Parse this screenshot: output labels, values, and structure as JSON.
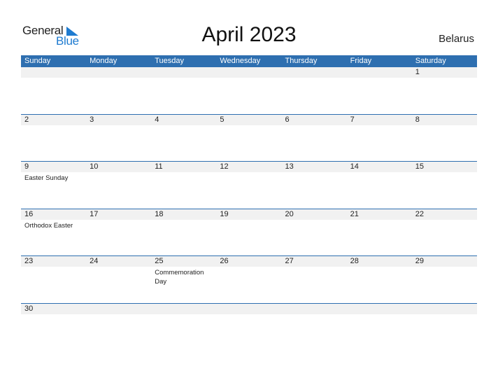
{
  "logo": {
    "text_general": "General",
    "text_blue": "Blue"
  },
  "title": "April 2023",
  "country": "Belarus",
  "colors": {
    "accent": "#2e6fb0",
    "band": "#f1f1f1"
  },
  "weekdays": [
    "Sunday",
    "Monday",
    "Tuesday",
    "Wednesday",
    "Thursday",
    "Friday",
    "Saturday"
  ],
  "weeks": [
    {
      "days": [
        {
          "n": "",
          "e": ""
        },
        {
          "n": "",
          "e": ""
        },
        {
          "n": "",
          "e": ""
        },
        {
          "n": "",
          "e": ""
        },
        {
          "n": "",
          "e": ""
        },
        {
          "n": "",
          "e": ""
        },
        {
          "n": "1",
          "e": ""
        }
      ]
    },
    {
      "days": [
        {
          "n": "2",
          "e": ""
        },
        {
          "n": "3",
          "e": ""
        },
        {
          "n": "4",
          "e": ""
        },
        {
          "n": "5",
          "e": ""
        },
        {
          "n": "6",
          "e": ""
        },
        {
          "n": "7",
          "e": ""
        },
        {
          "n": "8",
          "e": ""
        }
      ]
    },
    {
      "days": [
        {
          "n": "9",
          "e": "Easter Sunday"
        },
        {
          "n": "10",
          "e": ""
        },
        {
          "n": "11",
          "e": ""
        },
        {
          "n": "12",
          "e": ""
        },
        {
          "n": "13",
          "e": ""
        },
        {
          "n": "14",
          "e": ""
        },
        {
          "n": "15",
          "e": ""
        }
      ]
    },
    {
      "days": [
        {
          "n": "16",
          "e": "Orthodox Easter"
        },
        {
          "n": "17",
          "e": ""
        },
        {
          "n": "18",
          "e": ""
        },
        {
          "n": "19",
          "e": ""
        },
        {
          "n": "20",
          "e": ""
        },
        {
          "n": "21",
          "e": ""
        },
        {
          "n": "22",
          "e": ""
        }
      ]
    },
    {
      "days": [
        {
          "n": "23",
          "e": ""
        },
        {
          "n": "24",
          "e": ""
        },
        {
          "n": "25",
          "e": "Commemoration Day"
        },
        {
          "n": "26",
          "e": ""
        },
        {
          "n": "27",
          "e": ""
        },
        {
          "n": "28",
          "e": ""
        },
        {
          "n": "29",
          "e": ""
        }
      ]
    },
    {
      "days": [
        {
          "n": "30",
          "e": ""
        },
        {
          "n": "",
          "e": ""
        },
        {
          "n": "",
          "e": ""
        },
        {
          "n": "",
          "e": ""
        },
        {
          "n": "",
          "e": ""
        },
        {
          "n": "",
          "e": ""
        },
        {
          "n": "",
          "e": ""
        }
      ]
    }
  ]
}
